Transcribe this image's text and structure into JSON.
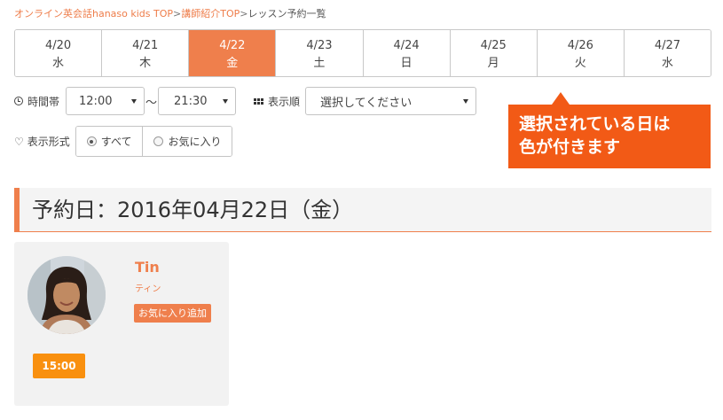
{
  "breadcrumb": {
    "home": "オンライン英会話hanaso kids TOP",
    "sep1": ">",
    "teachers": "講師紹介TOP",
    "sep2": ">",
    "current": "レッスン予約一覧"
  },
  "date_tabs": [
    {
      "date": "4/20",
      "day": "水",
      "selected": false
    },
    {
      "date": "4/21",
      "day": "木",
      "selected": false
    },
    {
      "date": "4/22",
      "day": "金",
      "selected": true
    },
    {
      "date": "4/23",
      "day": "土",
      "selected": false
    },
    {
      "date": "4/24",
      "day": "日",
      "selected": false
    },
    {
      "date": "4/25",
      "day": "月",
      "selected": false
    },
    {
      "date": "4/26",
      "day": "火",
      "selected": false
    },
    {
      "date": "4/27",
      "day": "水",
      "selected": false
    }
  ],
  "filters": {
    "time_label": "時間帯",
    "time_from": "12:00",
    "tilde": "〜",
    "time_to": "21:30",
    "order_label": "表示順",
    "order_placeholder": "選択してください",
    "display_label": "表示形式",
    "display_all": "すべて",
    "display_fav": "お気に入り"
  },
  "callout": {
    "line1": "選択されている日は",
    "line2": "色が付きます"
  },
  "reservation_heading": "予約日：2016年04月22日（金）",
  "teacher": {
    "name": "Tin",
    "kana": "ティン",
    "fav_button": "お気に入り追加",
    "slot": "15:00"
  },
  "colors": {
    "accent": "#ef7f4c",
    "callout": "#f25a16",
    "slot_button": "#f9900f"
  },
  "icons": {
    "time": "clock-icon",
    "order": "grid-icon",
    "display": "heart-icon"
  }
}
